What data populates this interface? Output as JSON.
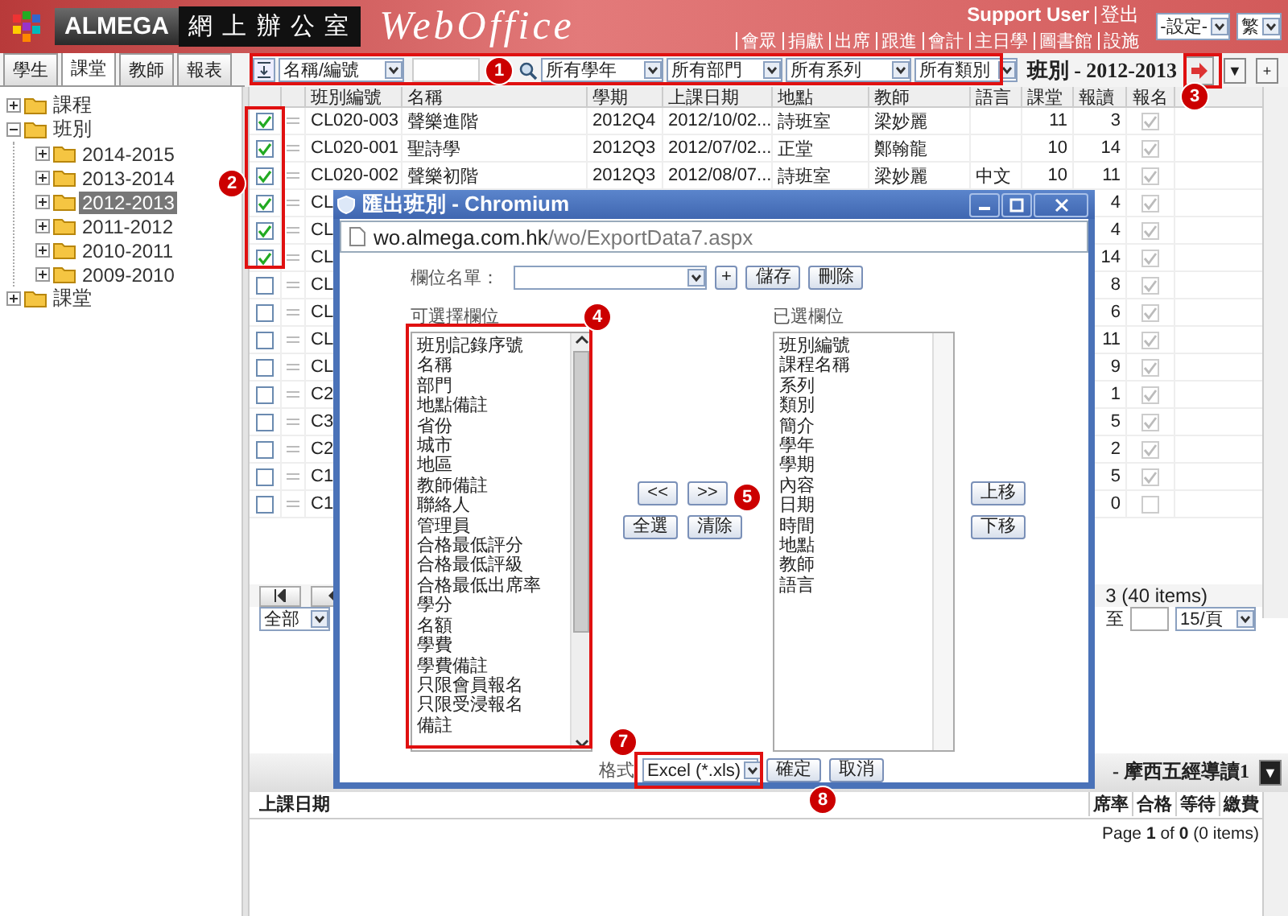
{
  "header": {
    "logo_text": "ALMEGA",
    "title_box": "網 上 辦 公 室",
    "product": "WebOffice",
    "user": "Support User",
    "logout": "登出",
    "nav": [
      "會眾",
      "捐獻",
      "出席",
      "跟進",
      "會計",
      "主日學",
      "圖書館",
      "設施"
    ],
    "settings_select": "-設定-",
    "lang_select": "繁"
  },
  "tabs": [
    {
      "label": "學生",
      "selected": false
    },
    {
      "label": "課堂",
      "selected": true
    },
    {
      "label": "教師",
      "selected": false
    },
    {
      "label": "報表",
      "selected": false
    }
  ],
  "toolbar": {
    "field_select": "名稱/編號",
    "filters": [
      "所有學年",
      "所有部門",
      "所有系列",
      "所有類別"
    ],
    "view_title": "班別 - 2012-2013",
    "menu_button": "▼",
    "add_button": "+"
  },
  "tree": [
    {
      "label": "課程",
      "expanded": false,
      "selected": false
    },
    {
      "label": "班別",
      "expanded": true,
      "selected": false,
      "children": [
        {
          "label": "2014-2015",
          "expanded": false,
          "selected": false
        },
        {
          "label": "2013-2014",
          "expanded": false,
          "selected": false
        },
        {
          "label": "2012-2013",
          "expanded": false,
          "selected": true
        },
        {
          "label": "2011-2012",
          "expanded": false,
          "selected": false
        },
        {
          "label": "2010-2011",
          "expanded": false,
          "selected": false
        },
        {
          "label": "2009-2010",
          "expanded": false,
          "selected": false
        }
      ]
    },
    {
      "label": "課堂",
      "expanded": false,
      "selected": false
    }
  ],
  "grid": {
    "columns": [
      "班別編號",
      "名稱",
      "學期",
      "上課日期",
      "地點",
      "教師",
      "語言",
      "課堂",
      "報讀",
      "報名"
    ],
    "rows": [
      {
        "checked": true,
        "code": "CL020-003",
        "name": "聲樂進階",
        "term": "2012Q4",
        "date": "2012/10/02...",
        "place": "詩班室",
        "teacher": "梁妙麗",
        "lessons": "11",
        "enrolled": "3",
        "registered": true
      },
      {
        "checked": true,
        "code": "CL020-001",
        "name": "聖詩學",
        "term": "2012Q3",
        "date": "2012/07/02...",
        "place": "正堂",
        "teacher": "鄭翰龍",
        "lessons": "10",
        "enrolled": "14",
        "registered": true
      },
      {
        "checked": true,
        "code": "CL020-002",
        "name": "聲樂初階",
        "term": "2012Q3",
        "date": "2012/08/07...",
        "place": "詩班室",
        "teacher": "梁妙麗",
        "lang": "中文",
        "lessons": "10",
        "enrolled": "11",
        "registered": true
      },
      {
        "checked": true,
        "code": "CL",
        "enrolled": "4",
        "registered": true
      },
      {
        "checked": true,
        "code": "CL",
        "enrolled": "4",
        "registered": true
      },
      {
        "checked": true,
        "code": "CL",
        "enrolled": "14",
        "registered": true
      },
      {
        "checked": false,
        "code": "CL",
        "enrolled": "8",
        "registered": true
      },
      {
        "checked": false,
        "code": "CL",
        "enrolled": "6",
        "registered": true
      },
      {
        "checked": false,
        "code": "CL",
        "enrolled": "11",
        "registered": true
      },
      {
        "checked": false,
        "code": "CL",
        "enrolled": "9",
        "registered": true
      },
      {
        "checked": false,
        "code": "C2",
        "enrolled": "1",
        "registered": true
      },
      {
        "checked": false,
        "code": "C3",
        "enrolled": "5",
        "registered": true
      },
      {
        "checked": false,
        "code": "C2",
        "enrolled": "2",
        "registered": true
      },
      {
        "checked": false,
        "code": "C1",
        "enrolled": "5",
        "registered": true
      },
      {
        "checked": false,
        "code": "C1",
        "enrolled": "0",
        "registered": false
      }
    ]
  },
  "pager": {
    "summary": "3 (40 items)",
    "filter_select": "全部",
    "goto_label": "至",
    "page_size": "15/頁"
  },
  "detail": {
    "title": "- 摩西五經導讀1",
    "menu_button": "▼",
    "columns": [
      "上課日期",
      "席率",
      "合格",
      "等待",
      "繳費"
    ],
    "pager": "Page **1** of **0** (0 items)"
  },
  "dialog": {
    "title": "匯出班別 - Chromium",
    "url_host": "wo.almega.com.hk",
    "url_path": "/wo/ExportData7.aspx",
    "list_label": "欄位名單：",
    "add_button": "+",
    "save_button": "儲存",
    "delete_button": "刪除",
    "available_label": "可選擇欄位",
    "selected_label": "已選欄位",
    "available": [
      "班別記錄序號",
      "名稱",
      "部門",
      "地點備註",
      "省份",
      "城市",
      "地區",
      "教師備註",
      "聯絡人",
      "管理員",
      "合格最低評分",
      "合格最低評級",
      "合格最低出席率",
      "學分",
      "名額",
      "學費",
      "學費備註",
      "只限會員報名",
      "只限受浸報名",
      "備註"
    ],
    "chosen": [
      "班別編號",
      "課程名稱",
      "系列",
      "類別",
      "簡介",
      "學年",
      "學期",
      "內容",
      "日期",
      "時間",
      "地點",
      "教師",
      "語言"
    ],
    "remove_all": "<<",
    "add_all": ">>",
    "select_all": "全選",
    "clear": "清除",
    "move_up": "上移",
    "move_down": "下移",
    "format_label": "格式",
    "format_select": "Excel (*.xls)",
    "ok": "確定",
    "cancel": "取消"
  },
  "callouts": [
    {
      "number": "1"
    },
    {
      "number": "2"
    },
    {
      "number": "3"
    },
    {
      "number": "4"
    },
    {
      "number": "5"
    },
    {
      "number": "7"
    },
    {
      "number": "8"
    }
  ]
}
